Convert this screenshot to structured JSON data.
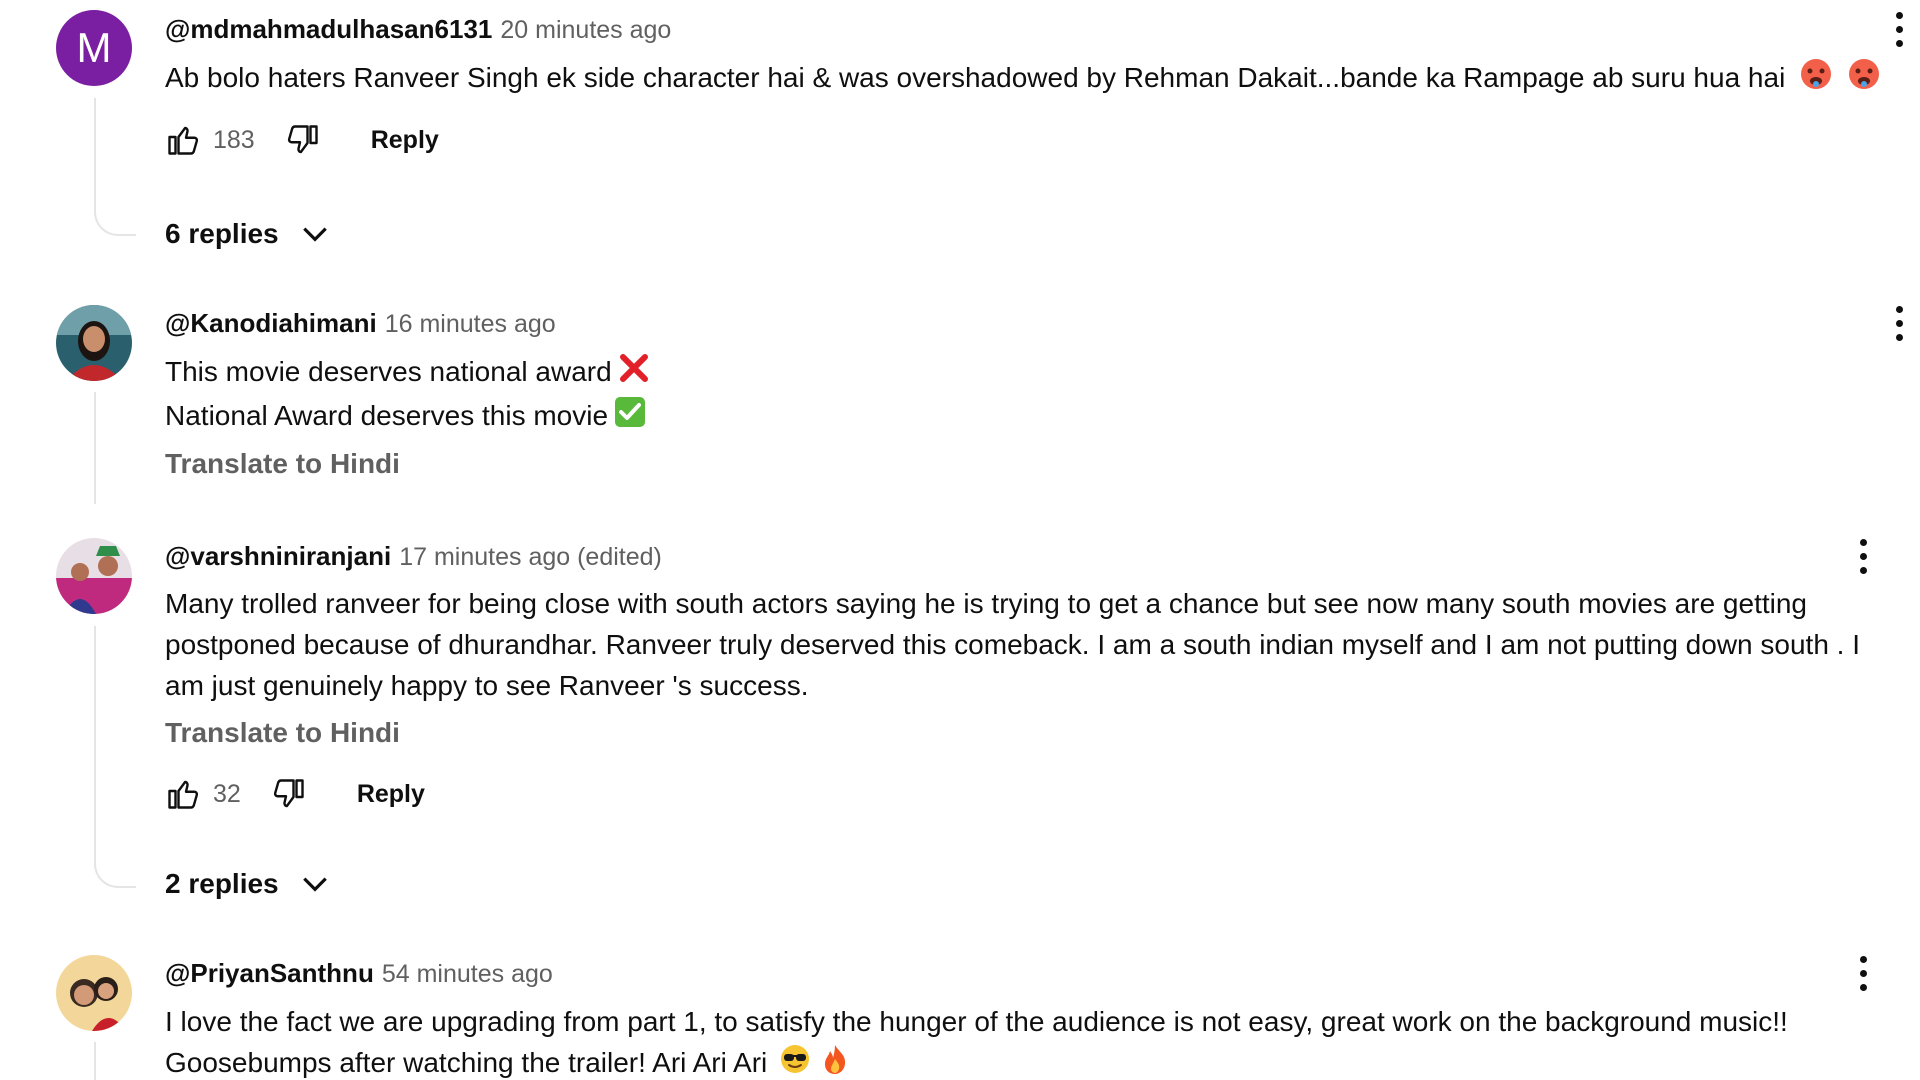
{
  "comments": [
    {
      "author": "@mdmahmadulhasan6131",
      "time": "20 minutes ago",
      "avatar_letter": "M",
      "avatar_color": "#7b1fa2",
      "text": "Ab bolo haters Ranveer Singh ek side character hai & was overshadowed by Rehman Dakait...bande ka Rampage ab suru hua hai",
      "emojis": [
        "hot-face",
        "hot-face"
      ],
      "likes": "183",
      "reply_label": "Reply",
      "replies_label": "6 replies"
    },
    {
      "author": "@Kanodiahimani",
      "time": "16 minutes ago",
      "lines": [
        {
          "text": "This movie deserves national award",
          "emoji": "cross-mark"
        },
        {
          "text": "National Award deserves this movie",
          "emoji": "check-mark"
        }
      ],
      "translate_label": "Translate to Hindi"
    },
    {
      "author": "@varshniniranjani",
      "time": "17 minutes ago (edited)",
      "lines": [
        "Many trolled ranveer for being close with south actors saying he is  trying to get a chance  but see now many south movies are getting",
        "postponed because of dhurandhar. Ranveer truly deserved this comeback. I am a south indian myself and I am not putting down south . I",
        "am just genuinely happy to see Ranveer 's success."
      ],
      "translate_label": "Translate to Hindi",
      "likes": "32",
      "reply_label": "Reply",
      "replies_label": "2 replies"
    },
    {
      "author": "@PriyanSanthnu",
      "time": "54 minutes ago",
      "lines": [
        "I love the fact we are upgrading from part 1, to satisfy the hunger of the audience is not easy, great work on the background music!!",
        "Goosebumps after watching the trailer! Ari Ari Ari"
      ],
      "emojis": [
        "sunglasses-face",
        "fire"
      ]
    }
  ]
}
